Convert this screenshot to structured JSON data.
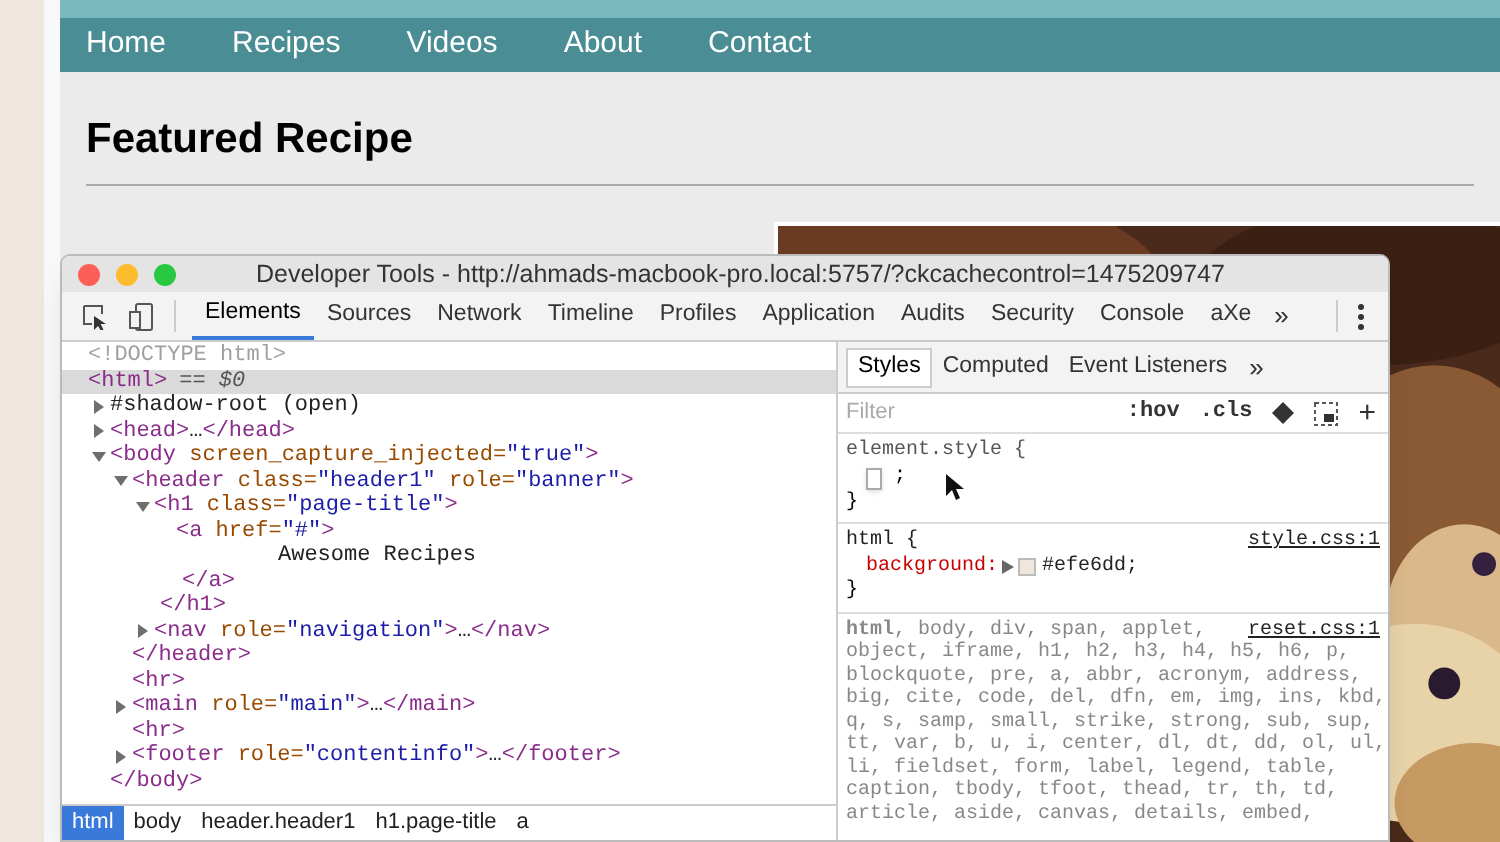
{
  "page": {
    "nav": [
      {
        "label": "Home"
      },
      {
        "label": "Recipes"
      },
      {
        "label": "Videos"
      },
      {
        "label": "About"
      },
      {
        "label": "Contact"
      }
    ],
    "heading": "Featured Recipe"
  },
  "devtools": {
    "title": "Developer Tools - http://ahmads-macbook-pro.local:5757/?ckcachecontrol=1475209747",
    "tabs": [
      {
        "label": "Elements",
        "selected": true
      },
      {
        "label": "Sources",
        "selected": false
      },
      {
        "label": "Network",
        "selected": false
      },
      {
        "label": "Timeline",
        "selected": false
      },
      {
        "label": "Profiles",
        "selected": false
      },
      {
        "label": "Application",
        "selected": false
      },
      {
        "label": "Audits",
        "selected": false
      },
      {
        "label": "Security",
        "selected": false
      },
      {
        "label": "Console",
        "selected": false
      },
      {
        "label": "aXe",
        "selected": false
      }
    ],
    "more_tabs": "»",
    "elements": {
      "nodes": [
        {
          "text": "<!DOCTYPE html>",
          "kind": "doctype",
          "selected": false
        },
        {
          "text": "<html>",
          "suffix": "== $0",
          "kind": "element",
          "selected": true,
          "children": [
            {
              "text": "#shadow-root (open)",
              "kind": "text",
              "expanded": false,
              "selected": false
            },
            {
              "text": "<head>…</head>",
              "kind": "element",
              "expanded": false,
              "selected": false
            },
            {
              "text": "<body screen_capture_injected=\"true\">",
              "kind": "element",
              "expanded": true,
              "selected": false,
              "close": "</body>",
              "children": [
                {
                  "text": "<header class=\"header1\" role=\"banner\">",
                  "kind": "element",
                  "expanded": true,
                  "selected": false,
                  "close": "</header>",
                  "children": [
                    {
                      "text": "<h1 class=\"page-title\">",
                      "kind": "element",
                      "expanded": true,
                      "selected": false,
                      "close": "</h1>",
                      "children": [
                        {
                          "text": "<a href=\"#\">",
                          "kind": "element",
                          "selected": false,
                          "close": "</a>",
                          "children": [
                            {
                              "text": "Awesome Recipes",
                              "kind": "text",
                              "selected": false
                            }
                          ]
                        }
                      ]
                    },
                    {
                      "text": "<nav role=\"navigation\">…</nav>",
                      "kind": "element",
                      "expanded": false,
                      "selected": false
                    }
                  ]
                },
                {
                  "text": "<hr>",
                  "kind": "element",
                  "selected": false
                },
                {
                  "text": "<main role=\"main\">…</main>",
                  "kind": "element",
                  "expanded": false,
                  "selected": false
                },
                {
                  "text": "<hr>",
                  "kind": "element",
                  "selected": false
                },
                {
                  "text": "<footer role=\"contentinfo\">…</footer>",
                  "kind": "element",
                  "expanded": false,
                  "selected": false
                }
              ]
            }
          ]
        }
      ]
    },
    "breadcrumbs": [
      {
        "label": "html",
        "selected": true
      },
      {
        "label": "body",
        "selected": false
      },
      {
        "label": "header.header1",
        "selected": false
      },
      {
        "label": "h1.page-title",
        "selected": false
      },
      {
        "label": "a",
        "selected": false
      }
    ],
    "styles": {
      "tabs": [
        {
          "label": "Styles",
          "selected": true
        },
        {
          "label": "Computed",
          "selected": false
        },
        {
          "label": "Event Listeners",
          "selected": false
        }
      ],
      "more_tabs": "»",
      "filter_placeholder": "Filter",
      "hov": ":hov",
      "cls": ".cls",
      "add": "+",
      "rules": [
        {
          "kind": "inline",
          "selector": "element.style {",
          "edit_text": ";",
          "close": "}"
        },
        {
          "kind": "declarations",
          "selector": "html {",
          "source": "style.css:1",
          "declarations": [
            {
              "property": "background:",
              "value": "#efe6dd;",
              "color": "#efe6dd"
            }
          ],
          "close": "}"
        },
        {
          "kind": "selector_list",
          "source": "reset.css:1",
          "lines": [
            "**html**, body, div, span, applet,",
            "object, iframe, h1, h2, h3, h4, h5, h6, p,",
            "blockquote, pre, a, abbr, acronym, address,",
            "big, cite, code, del, dfn, em, img, ins, kbd,",
            "q, s, samp, small, strike, strong, sub, sup,",
            "tt, var, b, u, i, center, dl, dt, dd, ol, ul,",
            "li, fieldset, form, label, legend, table,",
            "caption, tbody, tfoot, thead, tr, th, td,",
            "article, aside, canvas, details, embed,"
          ]
        }
      ]
    }
  }
}
